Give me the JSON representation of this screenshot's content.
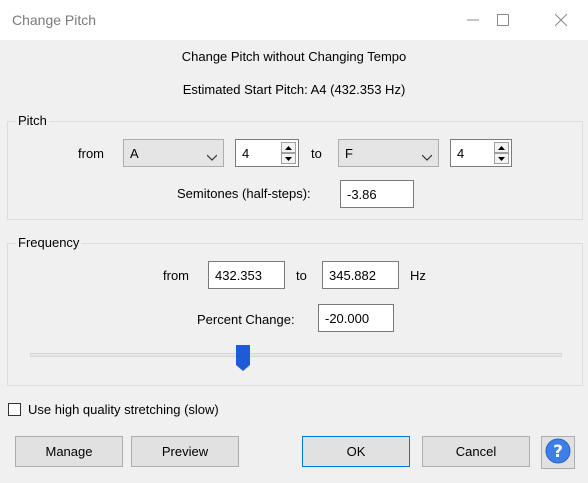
{
  "window": {
    "title": "Change Pitch",
    "minimize_icon": "minimize-icon",
    "maximize_icon": "maximize-icon",
    "close_icon": "close-icon"
  },
  "header": {
    "line1": "Change Pitch without Changing Tempo",
    "line2": "Estimated Start Pitch: A4 (432.353 Hz)"
  },
  "pitch": {
    "group_label": "Pitch",
    "from_label": "from",
    "from_note": "A",
    "from_octave": "4",
    "to_label": "to",
    "to_note": "F",
    "to_octave": "4",
    "semitones_label": "Semitones (half-steps):",
    "semitones_value": "-3.86"
  },
  "frequency": {
    "group_label": "Frequency",
    "from_label": "from",
    "from_value": "432.353",
    "to_label": "to",
    "to_value": "345.882",
    "unit": "Hz",
    "percent_label": "Percent Change:",
    "percent_value": "-20.000",
    "slider_position": 0.4
  },
  "options": {
    "hq_label": "Use high quality stretching (slow)",
    "hq_checked": false
  },
  "buttons": {
    "manage": "Manage",
    "preview": "Preview",
    "ok": "OK",
    "cancel": "Cancel",
    "help_icon": "help-icon"
  },
  "colors": {
    "accent": "#1e5bd6",
    "help": "#3d7fe6"
  }
}
